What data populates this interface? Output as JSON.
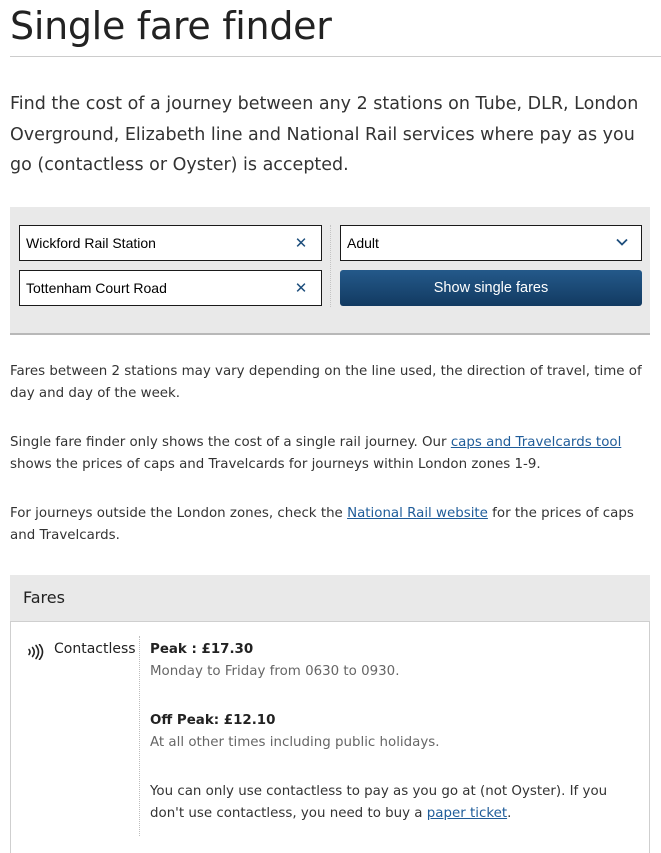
{
  "page": {
    "title": "Single fare finder",
    "intro": "Find the cost of a journey between any 2 stations on Tube, DLR, London Overground, Elizabeth line and National Rail services where pay as you go (contactless or Oyster) is accepted."
  },
  "search": {
    "from_value": "Wickford Rail Station",
    "to_value": "Tottenham Court Road",
    "clear_icon": "close-icon",
    "passenger_type": "Adult",
    "dropdown_icon": "chevron-down-icon",
    "submit_label": "Show single fares",
    "button_color": "#1b4b78"
  },
  "info": {
    "p1": "Fares between 2 stations may vary depending on the line used, the direction of travel, time of day and day of the week.",
    "p2_before": "Single fare finder only shows the cost of a single rail journey. Our ",
    "p2_link": "caps and Travelcards tool",
    "p2_after": " shows the prices of caps and Travelcards for journeys within London zones 1-9.",
    "p3_before": "For journeys outside the London zones, check the ",
    "p3_link": "National Rail website",
    "p3_after": " for the prices of caps and Travelcards."
  },
  "fares": {
    "heading": "Fares",
    "payment_icon": "contactless-icon",
    "payment_method": "Contactless",
    "peak_title": "Peak : £17.30",
    "peak_desc": "Monday to Friday from 0630 to 0930.",
    "offpeak_title": "Off Peak: £12.10",
    "offpeak_desc": "At all other times including public holidays.",
    "note_before": "You can only use contactless to pay as you go at (not Oyster). If you don't use contactless, you need to buy a ",
    "note_link": "paper ticket",
    "note_after": "."
  },
  "colors": {
    "link": "#1f5c99",
    "panel_background": "#e9e9e9"
  }
}
